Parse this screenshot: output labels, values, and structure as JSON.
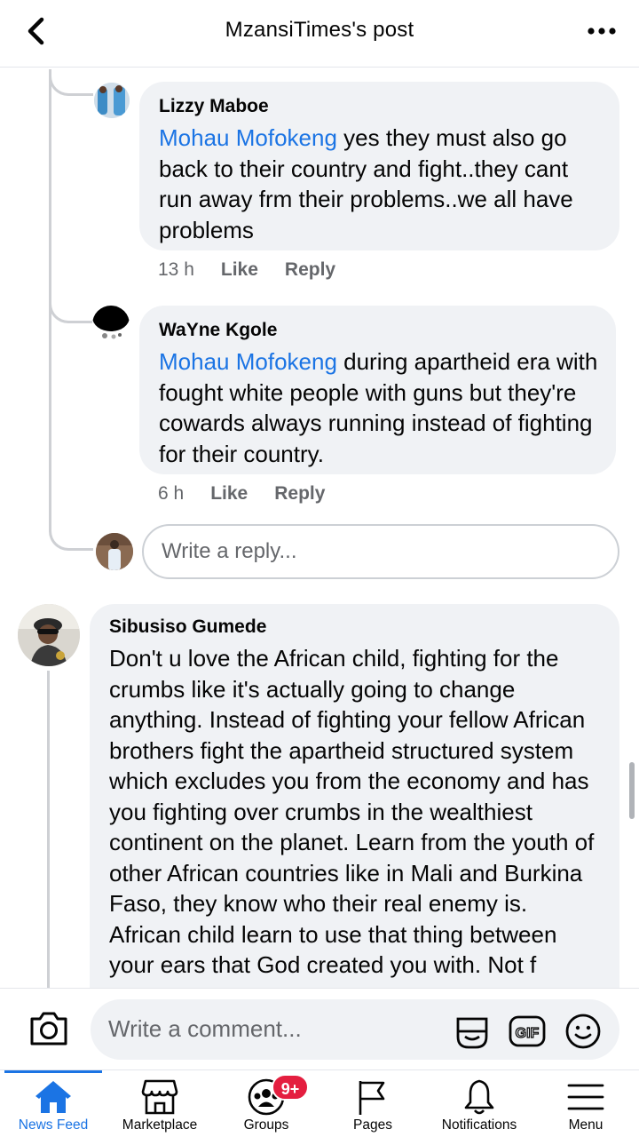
{
  "header": {
    "title": "MzansiTimes's post"
  },
  "replies": [
    {
      "author": "Lizzy Maboe",
      "mention": "Mohau Mofokeng",
      "text": " yes they must also go back to their country and fight..they cant run away frm their problems..we all have problems",
      "time": "13 h",
      "like_label": "Like",
      "reply_label": "Reply"
    },
    {
      "author": "WaYne Kgole",
      "mention": "Mohau Mofokeng",
      "text": " during apartheid era with fought white people with guns but they're cowards always running instead of fighting for their country.",
      "time": "6 h",
      "like_label": "Like",
      "reply_label": "Reply"
    }
  ],
  "reply_input": {
    "placeholder": "Write a reply..."
  },
  "comment": {
    "author": "Sibusiso Gumede",
    "text": "Don't u love the African child, fighting for the crumbs like it's actually going to change anything. Instead of fighting your fellow African brothers fight the apartheid structured system which excludes you from the economy and has you fighting over crumbs in the wealthiest continent on the planet. Learn from the youth of other African countries like in Mali and Burkina Faso, they know who their real enemy is. African child learn to use that thing between your ears that God created you with. Not f"
  },
  "composer": {
    "placeholder": "Write a comment..."
  },
  "nav": {
    "items": [
      {
        "label": "News Feed",
        "icon": "home-icon",
        "active": true
      },
      {
        "label": "Marketplace",
        "icon": "marketplace-icon"
      },
      {
        "label": "Groups",
        "icon": "groups-icon",
        "badge": "9+"
      },
      {
        "label": "Pages",
        "icon": "flag-icon"
      },
      {
        "label": "Notifications",
        "icon": "bell-icon"
      },
      {
        "label": "Menu",
        "icon": "hamburger-icon"
      }
    ]
  },
  "colors": {
    "accent": "#1b74e4",
    "bubble": "#f0f2f5",
    "badge": "#e41e3f",
    "muted": "#65676b"
  }
}
